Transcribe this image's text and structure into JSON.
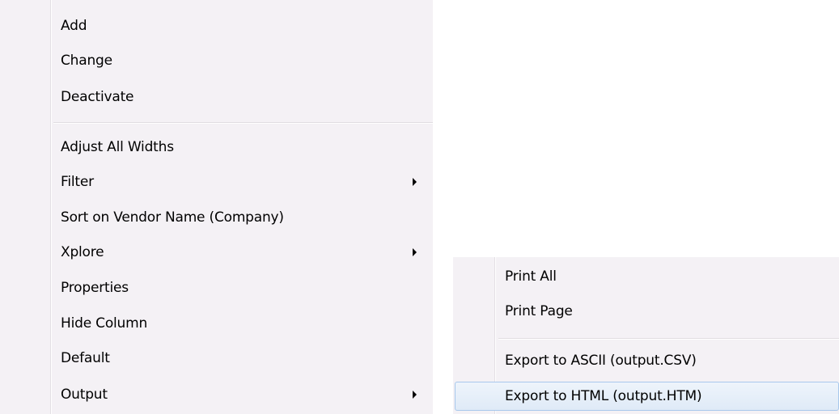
{
  "context_menu": {
    "items": [
      {
        "label": "Add"
      },
      {
        "label": "Change"
      },
      {
        "label": "Deactivate"
      },
      {
        "label": "Adjust All Widths"
      },
      {
        "label": "Filter"
      },
      {
        "label": "Sort on Vendor Name (Company)"
      },
      {
        "label": "Xplore"
      },
      {
        "label": "Properties"
      },
      {
        "label": "Hide Column"
      },
      {
        "label": "Default"
      },
      {
        "label": "Output"
      }
    ]
  },
  "output_submenu": {
    "items": [
      {
        "label": "Print All"
      },
      {
        "label": "Print Page"
      },
      {
        "label": "Export to ASCII (output.CSV)"
      },
      {
        "label": "Export to HTML (output.HTM)"
      }
    ]
  },
  "colors": {
    "menu_background": "#f4f1f5",
    "highlight_border": "#a8c8ec",
    "highlight_fill": "#dfeaf7"
  },
  "icons": {
    "submenu_arrow": "right-triangle"
  }
}
